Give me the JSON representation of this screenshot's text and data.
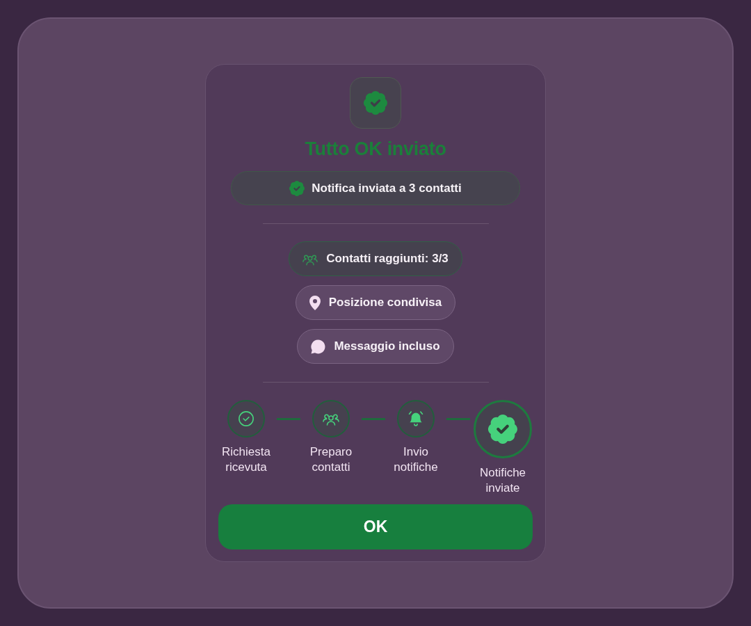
{
  "dialog": {
    "title": "Tutto OK inviato",
    "summary": {
      "text": "Notifica inviata a 3 contatti"
    },
    "chips": [
      {
        "kind": "success",
        "label": "Contatti raggiunti: 3/3"
      },
      {
        "kind": "info",
        "label": "Posizione condivisa"
      },
      {
        "kind": "info",
        "label": "Messaggio incluso"
      }
    ],
    "steps": [
      {
        "label": "Richiesta ricevuta",
        "current": false
      },
      {
        "label": "Preparo contatti",
        "current": false
      },
      {
        "label": "Invio notifiche",
        "current": false
      },
      {
        "label": "Notifiche inviate",
        "current": true
      }
    ],
    "buttons": [
      {
        "label": "OK"
      }
    ]
  }
}
